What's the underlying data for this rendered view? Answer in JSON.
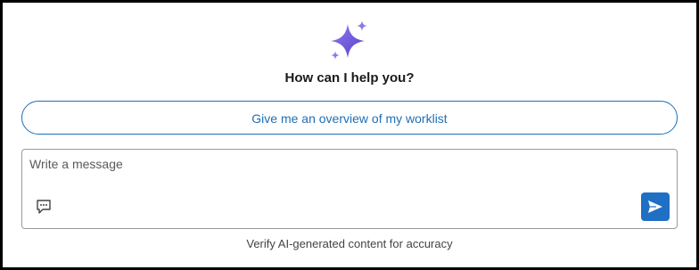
{
  "assistant": {
    "icon": "sparkle-icon",
    "greeting": "How can I help you?"
  },
  "suggestions": [
    {
      "label": "Give me an overview of my worklist"
    }
  ],
  "composer": {
    "placeholder": "Write a message",
    "value": "",
    "chat_icon": "chat-bubble-icon",
    "send_icon": "send-icon"
  },
  "footer": {
    "disclaimer": "Verify AI-generated content for accuracy"
  },
  "colors": {
    "accent": "#1f6fb5",
    "send_button": "#1f6fc5",
    "sparkle_primary": "#6a4fd8",
    "sparkle_secondary": "#8a7be6"
  }
}
